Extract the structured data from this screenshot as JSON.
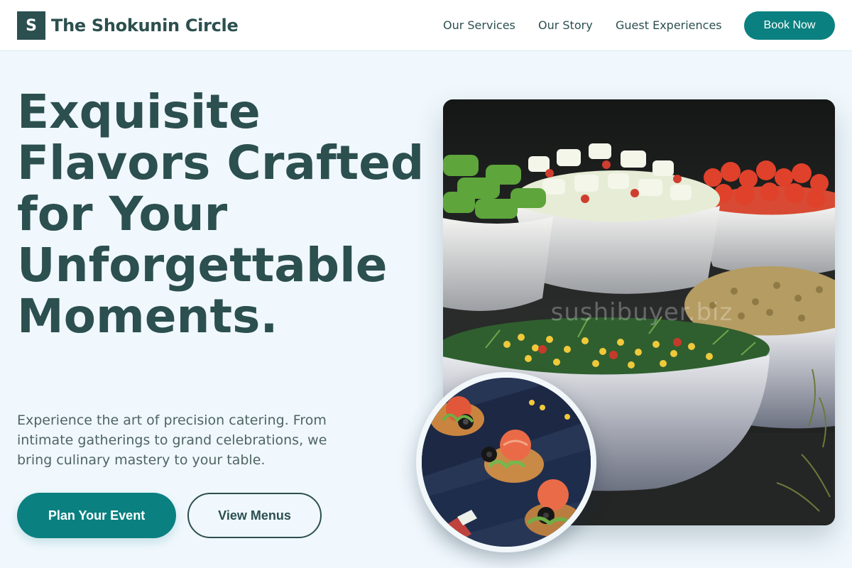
{
  "header": {
    "logo_letter": "S",
    "brand_name": "The Shokunin Circle",
    "nav": {
      "services": "Our Services",
      "story": "Our Story",
      "guests": "Guest Experiences"
    },
    "book_label": "Book Now"
  },
  "hero": {
    "headline": "Exquisite Flavors Crafted for Your Unforgettable Moments.",
    "subtext": "Experience the art of precision catering. From intimate gatherings to grand celebrations, we bring culinary mastery to your table.",
    "primary_cta": "Plan Your Event",
    "secondary_cta": "View Menus",
    "image_watermark": "sushibuyer.biz"
  },
  "colors": {
    "primary": "#0b8080",
    "dark": "#2c4f4f",
    "background": "#f0f8fd"
  }
}
